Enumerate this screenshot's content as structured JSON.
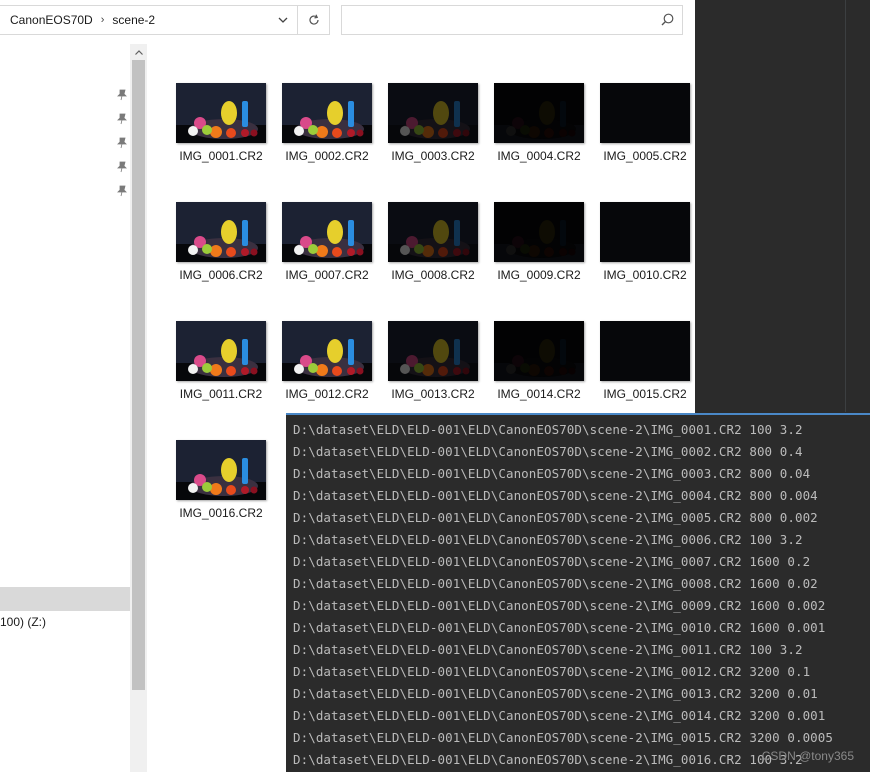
{
  "explorer": {
    "breadcrumb": [
      "CanonEOS70D",
      "scene-2"
    ],
    "search": {
      "placeholder": ""
    },
    "nav_drive_label": "100) (Z:)",
    "files": [
      {
        "name": "IMG_0001.CR2",
        "brightness": 1.0
      },
      {
        "name": "IMG_0002.CR2",
        "brightness": 1.0
      },
      {
        "name": "IMG_0003.CR2",
        "brightness": 0.35
      },
      {
        "name": "IMG_0004.CR2",
        "brightness": 0.06
      },
      {
        "name": "IMG_0005.CR2",
        "brightness": 0.0
      },
      {
        "name": "IMG_0006.CR2",
        "brightness": 1.0
      },
      {
        "name": "IMG_0007.CR2",
        "brightness": 1.0
      },
      {
        "name": "IMG_0008.CR2",
        "brightness": 0.35
      },
      {
        "name": "IMG_0009.CR2",
        "brightness": 0.06
      },
      {
        "name": "IMG_0010.CR2",
        "brightness": 0.0
      },
      {
        "name": "IMG_0011.CR2",
        "brightness": 1.0
      },
      {
        "name": "IMG_0012.CR2",
        "brightness": 1.0
      },
      {
        "name": "IMG_0013.CR2",
        "brightness": 0.35
      },
      {
        "name": "IMG_0014.CR2",
        "brightness": 0.06
      },
      {
        "name": "IMG_0015.CR2",
        "brightness": 0.0
      },
      {
        "name": "IMG_0016.CR2",
        "brightness": 1.0
      }
    ]
  },
  "terminal": {
    "lines": [
      "D:\\dataset\\ELD\\ELD-001\\ELD\\CanonEOS70D\\scene-2\\IMG_0001.CR2 100 3.2",
      "D:\\dataset\\ELD\\ELD-001\\ELD\\CanonEOS70D\\scene-2\\IMG_0002.CR2 800 0.4",
      "D:\\dataset\\ELD\\ELD-001\\ELD\\CanonEOS70D\\scene-2\\IMG_0003.CR2 800 0.04",
      "D:\\dataset\\ELD\\ELD-001\\ELD\\CanonEOS70D\\scene-2\\IMG_0004.CR2 800 0.004",
      "D:\\dataset\\ELD\\ELD-001\\ELD\\CanonEOS70D\\scene-2\\IMG_0005.CR2 800 0.002",
      "D:\\dataset\\ELD\\ELD-001\\ELD\\CanonEOS70D\\scene-2\\IMG_0006.CR2 100 3.2",
      "D:\\dataset\\ELD\\ELD-001\\ELD\\CanonEOS70D\\scene-2\\IMG_0007.CR2 1600 0.2",
      "D:\\dataset\\ELD\\ELD-001\\ELD\\CanonEOS70D\\scene-2\\IMG_0008.CR2 1600 0.02",
      "D:\\dataset\\ELD\\ELD-001\\ELD\\CanonEOS70D\\scene-2\\IMG_0009.CR2 1600 0.002",
      "D:\\dataset\\ELD\\ELD-001\\ELD\\CanonEOS70D\\scene-2\\IMG_0010.CR2 1600 0.001",
      "D:\\dataset\\ELD\\ELD-001\\ELD\\CanonEOS70D\\scene-2\\IMG_0011.CR2 100 3.2",
      "D:\\dataset\\ELD\\ELD-001\\ELD\\CanonEOS70D\\scene-2\\IMG_0012.CR2 3200 0.1",
      "D:\\dataset\\ELD\\ELD-001\\ELD\\CanonEOS70D\\scene-2\\IMG_0013.CR2 3200 0.01",
      "D:\\dataset\\ELD\\ELD-001\\ELD\\CanonEOS70D\\scene-2\\IMG_0014.CR2 3200 0.001",
      "D:\\dataset\\ELD\\ELD-001\\ELD\\CanonEOS70D\\scene-2\\IMG_0015.CR2 3200 0.0005",
      "D:\\dataset\\ELD\\ELD-001\\ELD\\CanonEOS70D\\scene-2\\IMG_0016.CR2 100 3.2"
    ],
    "watermark": "CSDN @tony365"
  },
  "icons": {
    "dropdown": "chevron-down-icon",
    "refresh": "refresh-icon",
    "search": "search-icon",
    "pin": "pin-icon",
    "scroll_up": "chevron-up-icon"
  },
  "colors": {
    "terminal_bg": "#2b2b2b",
    "terminal_text": "#bbbbbb",
    "terminal_border": "#4a88c7"
  }
}
